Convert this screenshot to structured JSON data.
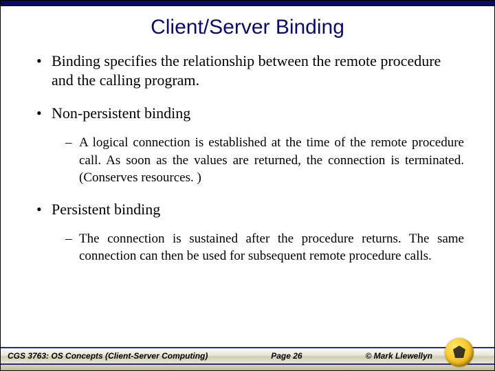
{
  "title": "Client/Server Binding",
  "bullets": {
    "b1": "Binding specifies the relationship between the remote procedure and the calling program.",
    "b2": "Non-persistent binding",
    "b2_sub": "A logical connection is established at the time of the remote procedure call.  As soon as the values are returned, the connection is terminated.  (Conserves resources. )",
    "b3": "Persistent binding",
    "b3_sub": "The connection is sustained after the procedure returns.  The same connection can then be used for subsequent remote procedure calls."
  },
  "footer": {
    "course": "CGS 3763: OS Concepts  (Client-Server Computing)",
    "page": "Page 26",
    "copyright": "© Mark Llewellyn"
  }
}
